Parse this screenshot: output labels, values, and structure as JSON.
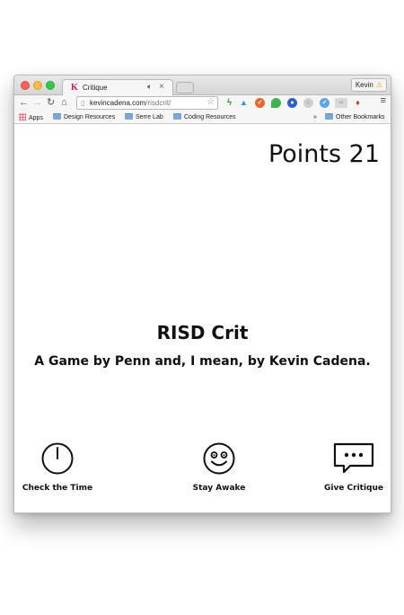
{
  "browser": {
    "tab": {
      "favicon": "K",
      "title": "Critique",
      "audio_icon": "speaker-icon",
      "close_glyph": "×"
    },
    "profile": {
      "name": "Kevin",
      "badge": "⚠"
    },
    "address": {
      "host": "kevincadena.com",
      "path": "/risdcrit/"
    },
    "bookmarks": [
      {
        "label": "Apps",
        "icon": "apps-grid-icon"
      },
      {
        "label": "Design Resources",
        "icon": "folder-icon"
      },
      {
        "label": "Serre Lab",
        "icon": "folder-icon"
      },
      {
        "label": "Coding Resources",
        "icon": "folder-icon"
      }
    ],
    "overflow_glyph": "»",
    "other_bookmarks": "Other Bookmarks"
  },
  "game": {
    "points_label": "Points 21",
    "title": "RISD Crit",
    "subtitle": "A Game by Penn and, I mean, by Kevin Cadena.",
    "actions": [
      {
        "label": "Check the Time",
        "icon": "clock-icon"
      },
      {
        "label": "Stay Awake",
        "icon": "smiley-icon"
      },
      {
        "label": "Give Critique",
        "icon": "speech-bubble-icon"
      }
    ]
  },
  "colors": {
    "close": "#fc605c",
    "minimize": "#fdbc40",
    "maximize": "#34c84a",
    "folder": "#7aa7d8",
    "text": "#111111"
  }
}
